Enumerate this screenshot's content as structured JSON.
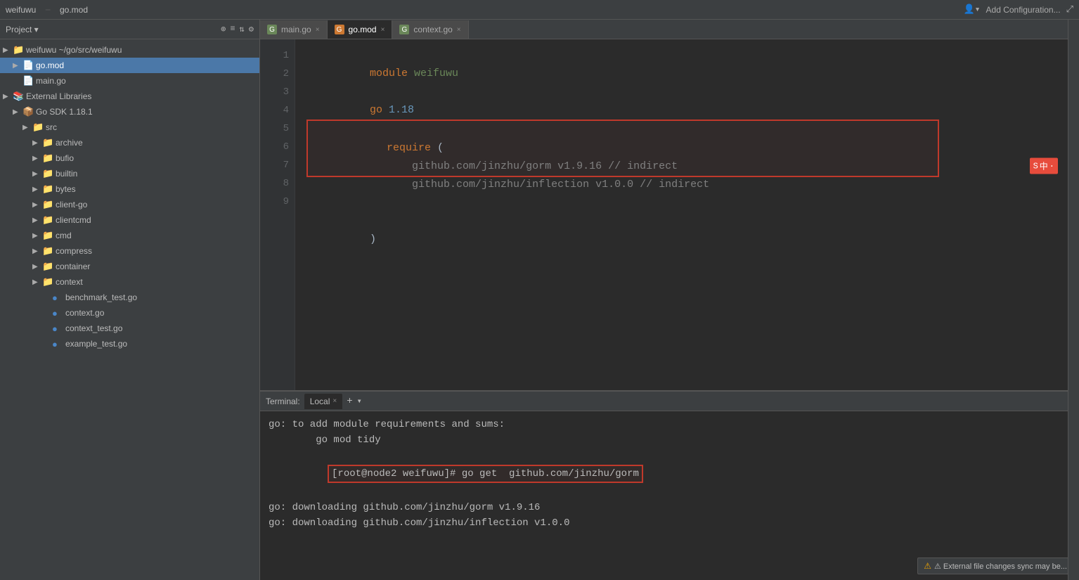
{
  "titlebar": {
    "app_name": "weifuwu",
    "separator": "–",
    "file_name": "go.mod",
    "add_config": "Add Configuration...",
    "icons": [
      "⊕",
      "≡",
      "⇅",
      "⚙",
      "—"
    ]
  },
  "sidebar": {
    "panel_title": "Project",
    "header_icons": [
      "⊕",
      "≡",
      "⇅",
      "⚙"
    ],
    "tree": [
      {
        "level": 0,
        "chevron": "▶",
        "icon": "📁",
        "label": "weifuwu ~/go/src/weifuwu",
        "type": "folder"
      },
      {
        "level": 1,
        "chevron": "▶",
        "icon": "📄",
        "label": "go.mod",
        "type": "file",
        "selected": true
      },
      {
        "level": 1,
        "chevron": " ",
        "icon": "📄",
        "label": "main.go",
        "type": "file"
      },
      {
        "level": 1,
        "chevron": "▶",
        "icon": "📚",
        "label": "External Libraries",
        "type": "folder"
      },
      {
        "level": 2,
        "chevron": "▶",
        "icon": "📦",
        "label": "Go SDK 1.18.1",
        "type": "folder"
      },
      {
        "level": 3,
        "chevron": "▶",
        "icon": "📁",
        "label": "src",
        "type": "folder"
      },
      {
        "level": 4,
        "chevron": "▶",
        "icon": "📁",
        "label": "archive",
        "type": "folder"
      },
      {
        "level": 4,
        "chevron": "▶",
        "icon": "📁",
        "label": "bufio",
        "type": "folder"
      },
      {
        "level": 4,
        "chevron": "▶",
        "icon": "📁",
        "label": "builtin",
        "type": "folder"
      },
      {
        "level": 4,
        "chevron": "▶",
        "icon": "📁",
        "label": "bytes",
        "type": "folder"
      },
      {
        "level": 4,
        "chevron": "▶",
        "icon": "📁",
        "label": "client-go",
        "type": "folder"
      },
      {
        "level": 4,
        "chevron": "▶",
        "icon": "📁",
        "label": "clientcmd",
        "type": "folder"
      },
      {
        "level": 4,
        "chevron": "▶",
        "icon": "📁",
        "label": "cmd",
        "type": "folder"
      },
      {
        "level": 4,
        "chevron": "▶",
        "icon": "📁",
        "label": "compress",
        "type": "folder"
      },
      {
        "level": 4,
        "chevron": "▶",
        "icon": "📁",
        "label": "container",
        "type": "folder"
      },
      {
        "level": 4,
        "chevron": "▶",
        "icon": "📁",
        "label": "context",
        "type": "folder"
      },
      {
        "level": 5,
        "chevron": " ",
        "icon": "🔵",
        "label": "benchmark_test.go",
        "type": "file"
      },
      {
        "level": 5,
        "chevron": " ",
        "icon": "🔵",
        "label": "context.go",
        "type": "file"
      },
      {
        "level": 5,
        "chevron": " ",
        "icon": "🔵",
        "label": "context_test.go",
        "type": "file"
      },
      {
        "level": 5,
        "chevron": " ",
        "icon": "🔵",
        "label": "example_test.go",
        "type": "file"
      }
    ]
  },
  "tabs": [
    {
      "label": "main.go",
      "active": false,
      "closable": true
    },
    {
      "label": "go.mod",
      "active": true,
      "closable": true
    },
    {
      "label": "context.go",
      "active": false,
      "closable": true
    }
  ],
  "editor": {
    "lines": [
      {
        "num": 1,
        "content": "module weifuwu",
        "parts": [
          {
            "text": "module ",
            "class": "kw-orange"
          },
          {
            "text": "weifuwu",
            "class": "kw-green"
          }
        ]
      },
      {
        "num": 2,
        "content": "",
        "parts": []
      },
      {
        "num": 3,
        "content": "go 1.18",
        "parts": [
          {
            "text": "go ",
            "class": "kw-orange"
          },
          {
            "text": "1.18",
            "class": "kw-blue"
          }
        ]
      },
      {
        "num": 4,
        "content": "",
        "parts": []
      },
      {
        "num": 5,
        "content": "require (",
        "parts": [
          {
            "text": "require ",
            "class": "kw-orange"
          },
          {
            "text": "(",
            "class": "kw-white"
          }
        ],
        "highlight": true
      },
      {
        "num": 6,
        "content": "    github.com/jinzhu/gorm v1.9.16 // indirect",
        "parts": [
          {
            "text": "    github.com/jinzhu/gorm v1.9.16 ",
            "class": "kw-gray"
          },
          {
            "text": "// indirect",
            "class": "kw-comment"
          }
        ],
        "highlight": true
      },
      {
        "num": 7,
        "content": "    github.com/jinzhu/inflection v1.0.0 // indirect",
        "parts": [
          {
            "text": "    github.com/jinzhu/inflection v1.0.0 ",
            "class": "kw-gray"
          },
          {
            "text": "// indirect",
            "class": "kw-comment"
          }
        ],
        "highlight": true
      },
      {
        "num": 8,
        "content": ")",
        "parts": [
          {
            "text": ")",
            "class": "kw-white"
          }
        ]
      },
      {
        "num": 9,
        "content": "",
        "parts": []
      }
    ]
  },
  "terminal": {
    "label": "Terminal:",
    "tab_label": "Local",
    "lines": [
      {
        "text": "go: to add module requirements and sums:",
        "type": "normal"
      },
      {
        "text": "\tgo mod tidy",
        "type": "normal"
      },
      {
        "text": "[root@node2 weifuwu]# go get  github.com/jinzhu/gorm",
        "type": "command"
      },
      {
        "text": "go: downloading github.com/jinzhu/gorm v1.9.16",
        "type": "normal"
      },
      {
        "text": "go: downloading github.com/jinzhu/inflection v1.0.0",
        "type": "normal"
      }
    ],
    "ext_notice": "⚠ External file changes sync may be..."
  },
  "ime": {
    "icon": "S",
    "text": "中"
  }
}
